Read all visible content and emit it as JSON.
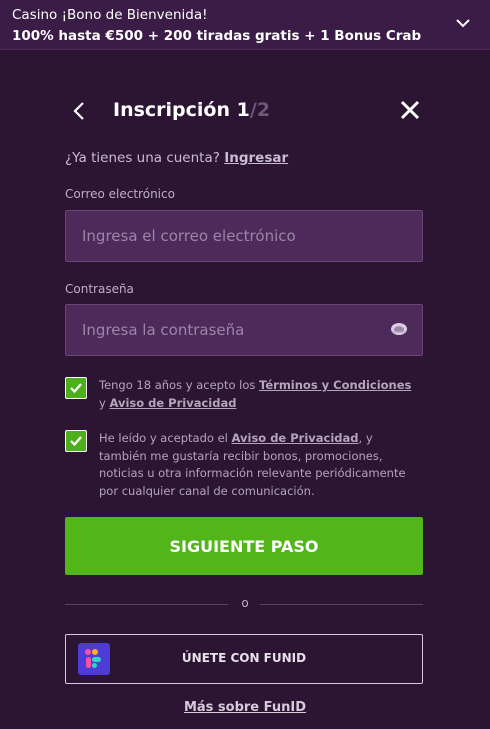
{
  "banner": {
    "line1": "Casino ¡Bono de Bienvenida!",
    "line2": "100% hasta €500 + 200 tiradas gratis + 1 Bonus Crab",
    "toggle_icon": "chevron-down-icon"
  },
  "header": {
    "title": "Inscripción",
    "step_current": "1",
    "step_separator": "/",
    "step_total": "2",
    "back_icon": "chevron-left-icon",
    "close_icon": "close-icon"
  },
  "login": {
    "question": "¿Ya tienes una cuenta?",
    "link_label": "Ingresar"
  },
  "form": {
    "email_label": "Correo electrónico",
    "email_placeholder": "Ingresa el correo electrónico",
    "email_value": "",
    "password_label": "Contraseña",
    "password_placeholder": "Ingresa la contraseña",
    "password_value": "",
    "password_toggle_icon": "eye-icon"
  },
  "consents": {
    "age": {
      "checked": true,
      "text_before": "Tengo 18 años y acepto los",
      "terms_link": "Términos y Condiciones",
      "conjunction": "y",
      "privacy_link": "Aviso de Privacidad"
    },
    "privacy": {
      "checked": true,
      "text_before": "He leído y aceptado el",
      "privacy_link": "Aviso de Privacidad",
      "text_after": ", y también me gustaría recibir bonos, promociones, noticias u otra información relevante periódicamente por cualquier canal de comunicación."
    }
  },
  "actions": {
    "next_label": "SIGUIENTE PASO",
    "divider_label": "o",
    "funid_label": "ÚNETE CON FUNID",
    "funid_icon": "funid-logo-icon",
    "more_funid_label": "Más sobre FunID"
  },
  "colors": {
    "background": "#2b1533",
    "banner": "#3a1c46",
    "input_bg": "#4d2a5a",
    "accent_green": "#52b519",
    "funid_purple": "#4f3cd6"
  }
}
